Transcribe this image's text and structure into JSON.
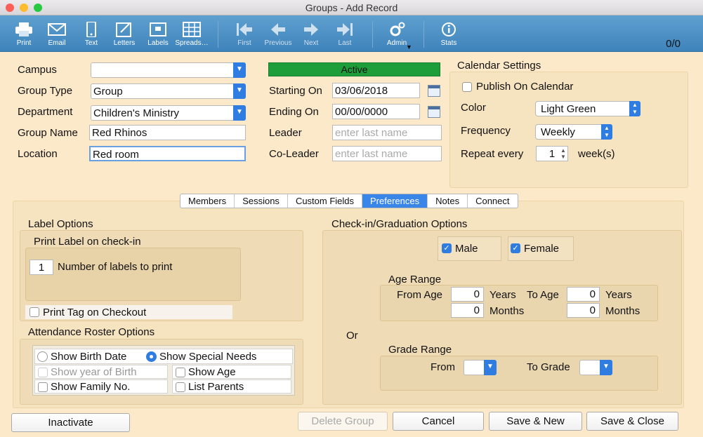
{
  "window": {
    "title": "Groups - Add Record"
  },
  "toolbar": {
    "print": "Print",
    "email": "Email",
    "text": "Text",
    "letters": "Letters",
    "labels": "Labels",
    "spreads": "Spreads…",
    "first": "First",
    "previous": "Previous",
    "next": "Next",
    "last": "Last",
    "admin": "Admin",
    "stats": "Stats",
    "counter": "0/0"
  },
  "form": {
    "campus_label": "Campus",
    "campus_value": "",
    "group_type_label": "Group Type",
    "group_type_value": "Group",
    "department_label": "Department",
    "department_value": "Children's Ministry",
    "group_name_label": "Group Name",
    "group_name_value": "Red Rhinos",
    "location_label": "Location",
    "location_value": "Red room",
    "status": "Active",
    "starting_label": "Starting On",
    "starting_value": "03/06/2018",
    "ending_label": "Ending On",
    "ending_value": "00/00/0000",
    "leader_label": "Leader",
    "leader_placeholder": "enter last name",
    "coleader_label": "Co-Leader",
    "coleader_placeholder": "enter last name"
  },
  "calendar": {
    "title": "Calendar Settings",
    "publish_label": "Publish On Calendar",
    "publish_checked": false,
    "color_label": "Color",
    "color_value": "Light Green",
    "frequency_label": "Frequency",
    "frequency_value": "Weekly",
    "repeat_label": "Repeat every",
    "repeat_value": "1",
    "repeat_unit": "week(s)"
  },
  "tabs": [
    "Members",
    "Sessions",
    "Custom Fields",
    "Preferences",
    "Notes",
    "Connect"
  ],
  "active_tab": "Preferences",
  "label_options": {
    "title": "Label Options",
    "sub": "Print Label on check-in",
    "count": "1",
    "count_label": "Number of labels to print",
    "print_tag": "Print Tag on Checkout",
    "print_tag_checked": false
  },
  "roster": {
    "title": "Attendance Roster Options",
    "birth_date": "Show Birth Date",
    "special_needs": "Show Special Needs",
    "year_of_birth": "Show year of Birth",
    "show_age": "Show Age",
    "family_no": "Show Family No.",
    "list_parents": "List Parents"
  },
  "checkin": {
    "title": "Check-in/Graduation Options",
    "male": "Male",
    "female": "Female",
    "age_range": "Age Range",
    "from_age": "From Age",
    "to_age": "To Age",
    "years": "Years",
    "months": "Months",
    "from_years": "0",
    "from_months": "0",
    "to_years": "0",
    "to_months": "0",
    "or": "Or",
    "grade_range": "Grade Range",
    "from": "From",
    "to_grade": "To Grade"
  },
  "buttons": {
    "inactivate": "Inactivate",
    "delete": "Delete Group",
    "cancel": "Cancel",
    "save_new": "Save & New",
    "save_close": "Save & Close"
  },
  "colors": {
    "accent": "#2f7de0",
    "active_bar": "#1e9e3b",
    "toolbar": "#4a8ec6",
    "bg": "#fce9c9"
  }
}
